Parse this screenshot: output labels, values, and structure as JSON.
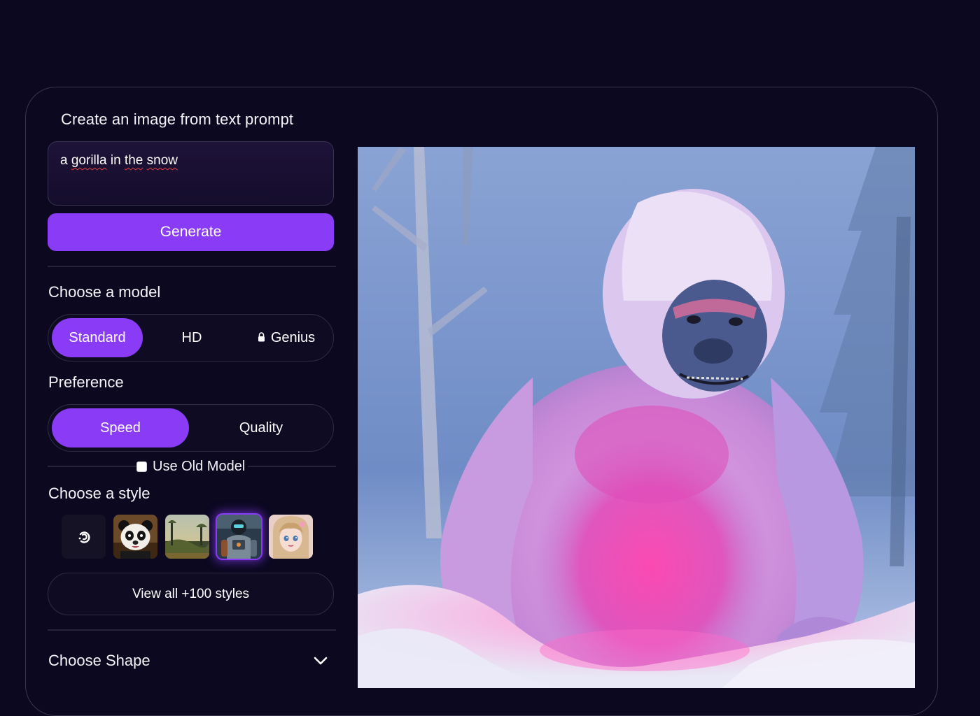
{
  "panel": {
    "title": "Create an image from text prompt"
  },
  "prompt": {
    "value_word_1": "a",
    "value_word_2": "gorilla",
    "value_word_3": "in",
    "value_word_4": "the",
    "value_word_5": "snow",
    "full_value": "a gorilla in the snow"
  },
  "generate": {
    "label": "Generate"
  },
  "model": {
    "label": "Choose a model",
    "options": [
      {
        "label": "Standard",
        "active": true
      },
      {
        "label": "HD",
        "active": false
      },
      {
        "label": "Genius",
        "active": false,
        "locked": true
      }
    ]
  },
  "preference": {
    "label": "Preference",
    "options": [
      {
        "label": "Speed",
        "active": true
      },
      {
        "label": "Quality",
        "active": false
      }
    ]
  },
  "old_model": {
    "label": "Use Old Model",
    "checked": false
  },
  "style": {
    "label": "Choose a style",
    "thumbnails": [
      {
        "icon": "random-swirl-icon"
      },
      {
        "icon": "panda-style"
      },
      {
        "icon": "landscape-style"
      },
      {
        "icon": "robot-style",
        "selected": true
      },
      {
        "icon": "anime-girl-style"
      }
    ],
    "view_all_label": "View all +100 styles"
  },
  "shape": {
    "label": "Choose Shape",
    "icon": "chevron-down-icon"
  },
  "colors": {
    "accent": "#8a3bf6",
    "background": "#0b0820",
    "border": "#302e42"
  }
}
